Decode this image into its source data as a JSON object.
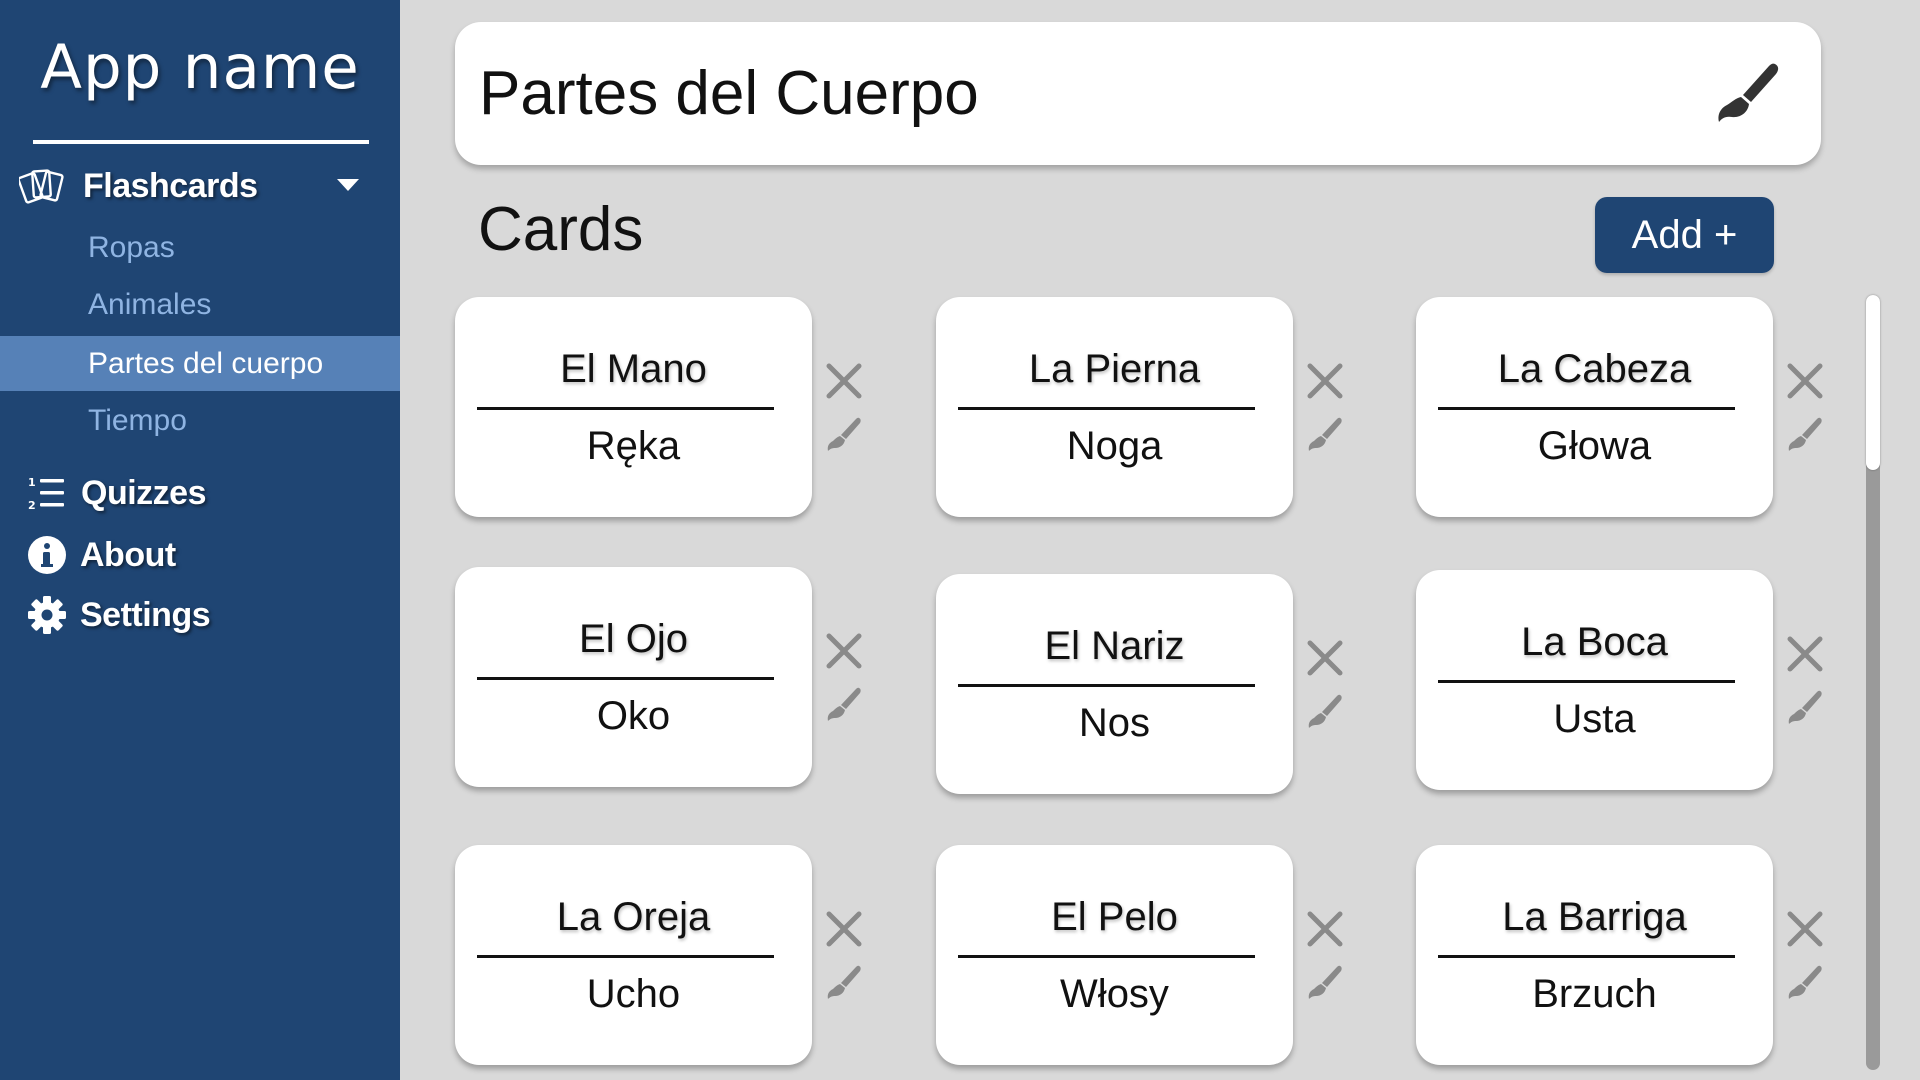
{
  "app": {
    "name": "App name"
  },
  "sidebar": {
    "flashcards": {
      "label": "Flashcards",
      "icon": "cards-icon"
    },
    "decks": [
      {
        "label": "Ropas",
        "active": false
      },
      {
        "label": "Animales",
        "active": false
      },
      {
        "label": "Partes del cuerpo",
        "active": true
      },
      {
        "label": "Tiempo",
        "active": false
      }
    ],
    "quizzes": {
      "label": "Quizzes",
      "icon": "list-icon"
    },
    "about": {
      "label": "About",
      "icon": "info-icon"
    },
    "settings": {
      "label": "Settings",
      "icon": "gear-icon"
    }
  },
  "deck": {
    "title": "Partes del Cuerpo",
    "edit_icon": "paintbrush-icon"
  },
  "cards_section": {
    "heading": "Cards",
    "add_label": "Add +"
  },
  "cards": [
    {
      "front": "El Mano",
      "back": "Ręka"
    },
    {
      "front": "La Pierna",
      "back": "Noga"
    },
    {
      "front": "La Cabeza",
      "back": "Głowa"
    },
    {
      "front": "El Ojo",
      "back": "Oko"
    },
    {
      "front": "El Nariz",
      "back": "Nos"
    },
    {
      "front": "La Boca",
      "back": "Usta"
    },
    {
      "front": "La Oreja",
      "back": "Ucho"
    },
    {
      "front": "El Pelo",
      "back": "Włosy"
    },
    {
      "front": "La Barriga",
      "back": "Brzuch"
    }
  ],
  "colors": {
    "sidebar_bg": "#1f4573",
    "active_item_bg": "#5681b7",
    "sub_item_text": "#8fb4e2",
    "content_bg": "#d9d9d9",
    "card_bg": "#ffffff",
    "icon_gray": "#8a8a8a",
    "primary_button": "#1f4573"
  }
}
